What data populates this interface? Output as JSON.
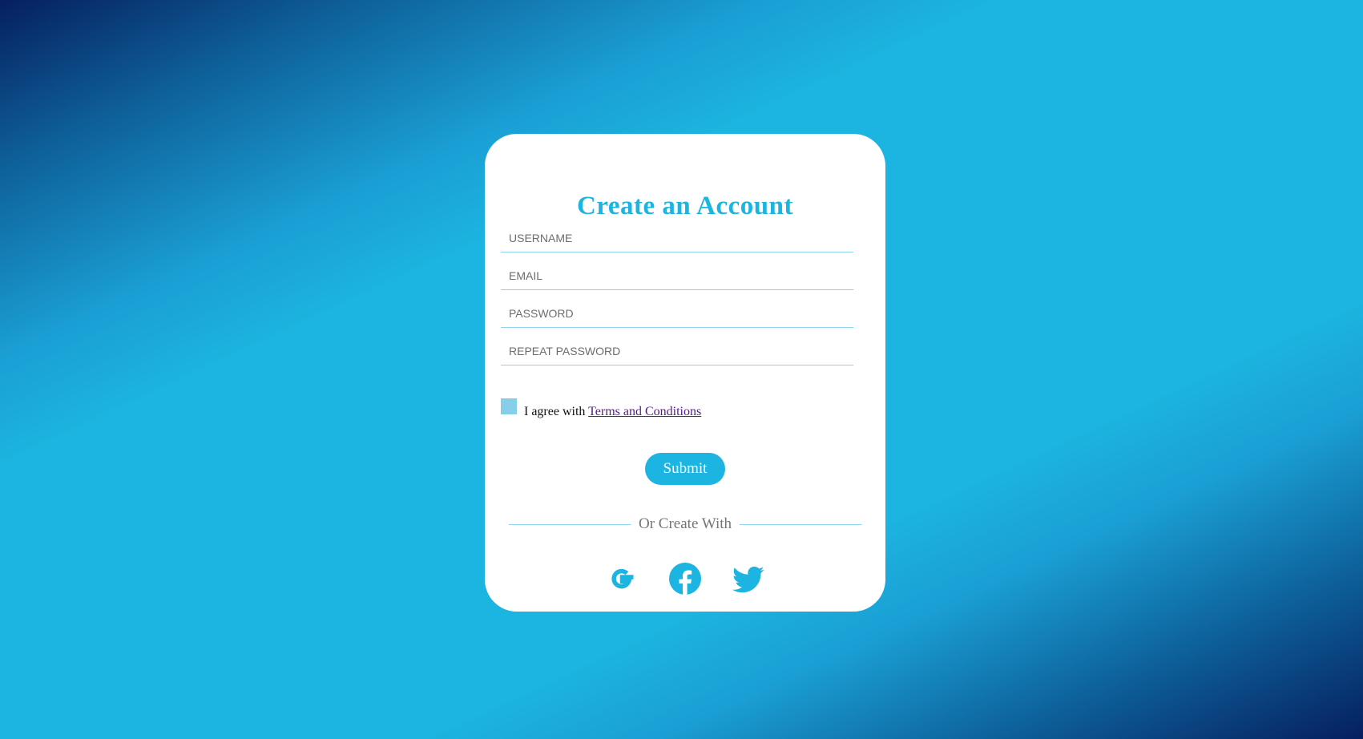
{
  "theme": {
    "accent": "#1cb4e0",
    "field_underline": "#8fd3ec",
    "checkbox": "#87ceeb",
    "link": "#551a8b",
    "divider_text": "#757575"
  },
  "form": {
    "title": "Create an Account",
    "fields": [
      {
        "name": "username",
        "placeholder": "USERNAME",
        "value": ""
      },
      {
        "name": "email",
        "placeholder": "EMAIL",
        "value": ""
      },
      {
        "name": "password",
        "placeholder": "PASSWORD",
        "value": ""
      },
      {
        "name": "repeat-password",
        "placeholder": "REPEAT PASSWORD",
        "value": ""
      }
    ],
    "agree": {
      "checked": false,
      "text": "I agree with ",
      "link_text": "Terms and Conditions"
    },
    "submit_label": "Submit",
    "divider_text": "Or Create With",
    "socials": [
      {
        "icon": "google-icon"
      },
      {
        "icon": "facebook-icon"
      },
      {
        "icon": "twitter-icon"
      }
    ]
  }
}
